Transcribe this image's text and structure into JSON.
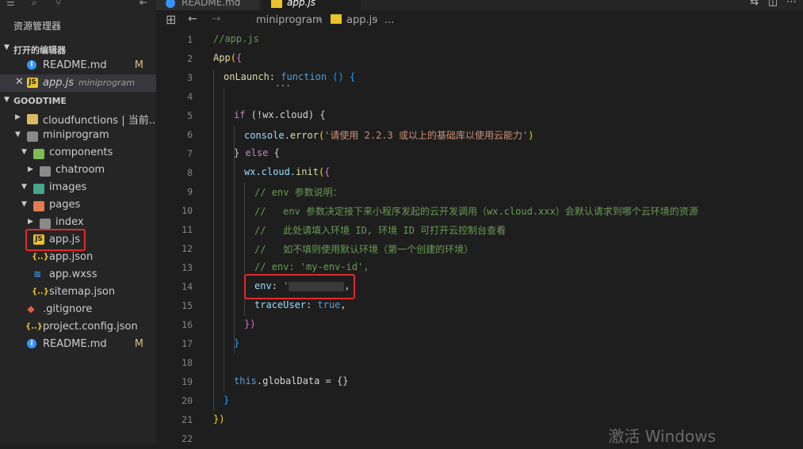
{
  "sidebar": {
    "title": "资源管理器",
    "open_editors_header": "打开的编辑器",
    "open_editors": [
      {
        "name": "README.md",
        "badge": "M",
        "icon": "info-icon"
      },
      {
        "name": "app.js",
        "desc": "miniprogram",
        "icon": "js-icon"
      }
    ],
    "project_header": "GOODTIME",
    "tree": [
      {
        "name": "cloudfunctions | 当前...",
        "icon": "folder-icon"
      },
      {
        "name": "miniprogram",
        "icon": "folder-icon"
      },
      {
        "name": "components",
        "icon": "folder-icon"
      },
      {
        "name": "chatroom",
        "icon": "folder-icon"
      },
      {
        "name": "images",
        "icon": "folder-icon"
      },
      {
        "name": "pages",
        "icon": "folder-icon"
      },
      {
        "name": "index",
        "icon": "folder-icon"
      },
      {
        "name": "app.js",
        "icon": "js-icon"
      },
      {
        "name": "app.json",
        "icon": "json-icon"
      },
      {
        "name": "app.wxss",
        "icon": "css-icon"
      },
      {
        "name": "sitemap.json",
        "icon": "json-icon"
      },
      {
        "name": ".gitignore",
        "icon": "git-icon"
      },
      {
        "name": "project.config.json",
        "icon": "json-icon"
      },
      {
        "name": "README.md",
        "badge": "M",
        "icon": "info-icon"
      }
    ]
  },
  "tabs": [
    {
      "label": "README.md"
    },
    {
      "label": "app.js"
    }
  ],
  "breadcrumb": {
    "folder": "miniprogram",
    "file": "app.js",
    "more": "..."
  },
  "editor": {
    "lines": [
      "1",
      "2",
      "3",
      "4",
      "5",
      "6",
      "7",
      "8",
      "9",
      "10",
      "11",
      "12",
      "13",
      "14",
      "15",
      "16",
      "17",
      "18",
      "19",
      "20",
      "21",
      "22"
    ],
    "code": {
      "l1": "//app.js",
      "l2_fn": "App",
      "l3_prop": "onLaunch",
      "l3_kw": "function",
      "l3_rest": " () {",
      "l3_fold": "...",
      "l5_kw": "if",
      "l5_rest": " (!wx.cloud) {",
      "l6_obj": "console",
      "l6_fn": "error",
      "l6_str": "'请使用 2.2.3 或以上的基础库以使用云能力'",
      "l7_close": "} ",
      "l7_kw": "else",
      "l7_rest": " {",
      "l8_obj": "wx.cloud.",
      "l8_fn": "init",
      "l9": "// env 参数说明：",
      "l10": "//   env 参数决定接下来小程序发起的云开发调用（wx.cloud.xxx）会默认请求到哪个云环境的资源",
      "l11": "//   此处请填入环境 ID, 环境 ID 可打开云控制台查看",
      "l12": "//   如不填则使用默认环境（第一个创建的环境）",
      "l13": "// env: 'my-env-id',",
      "l14_prop": "env",
      "l14_str": "'",
      "l14_end": ",",
      "l15_prop": "traceUser",
      "l15_val": "true",
      "l16": "})",
      "l17": "}",
      "l19_kw": "this",
      "l19_rest": ".globalData = {}",
      "l20": "}",
      "l21": "})"
    }
  },
  "watermark": "激活 Windows"
}
